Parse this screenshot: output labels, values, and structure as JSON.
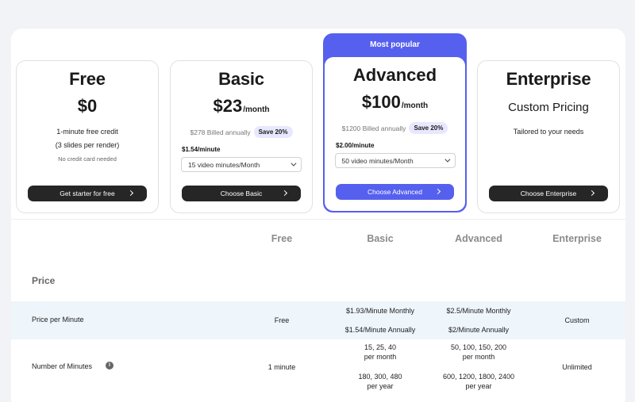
{
  "plans": {
    "free": {
      "name": "Free",
      "price": "$0",
      "line1": "1-minute free credit",
      "line2": "(3 slides per render)",
      "note": "No credit card needed",
      "cta": "Get starter for free"
    },
    "basic": {
      "name": "Basic",
      "price": "$23",
      "period": "/month",
      "billed": "$278 Billed annually",
      "save": "Save 20%",
      "per_minute": "$1.54/minute",
      "select_value": "15 video minutes/Month",
      "cta": "Choose Basic"
    },
    "advanced": {
      "banner": "Most popular",
      "name": "Advanced",
      "price": "$100",
      "period": "/month",
      "billed": "$1200 Billed annually",
      "save": "Save 20%",
      "per_minute": "$2.00/minute",
      "select_value": "50 video minutes/Month",
      "cta": "Choose Advanced"
    },
    "enterprise": {
      "name": "Enterprise",
      "price": "Custom Pricing",
      "tagline": "Tailored to your needs",
      "cta": "Choose Enterprise"
    }
  },
  "colors": {
    "accent": "#5660ee",
    "dark_button": "#262626",
    "badge_bg": "#e7e8ff",
    "row_band": "#eef5fb"
  },
  "table": {
    "columns": [
      "Free",
      "Basic",
      "Advanced",
      "Enterprise"
    ],
    "section": "Price",
    "rows": [
      {
        "label": "Price per Minute",
        "free": "Free",
        "basic": [
          "$1.93/Minute Monthly",
          "$1.54/Minute Annually"
        ],
        "advanced": [
          "$2.5/Minute Monthly",
          "$2/Minute Annually"
        ],
        "enterprise": "Custom"
      },
      {
        "label": "Number of Minutes",
        "free": "1 minute",
        "basic": [
          "15, 25, 40",
          "per month",
          "180, 300, 480",
          "per year"
        ],
        "advanced": [
          "50, 100, 150, 200",
          "per month",
          "600, 1200, 1800, 2400",
          "per year"
        ],
        "enterprise": "Unlimited"
      }
    ]
  },
  "icons": {
    "info": "info-icon",
    "chevron_down": "chevron-down-icon",
    "chevron_right": "chevron-right-icon"
  }
}
